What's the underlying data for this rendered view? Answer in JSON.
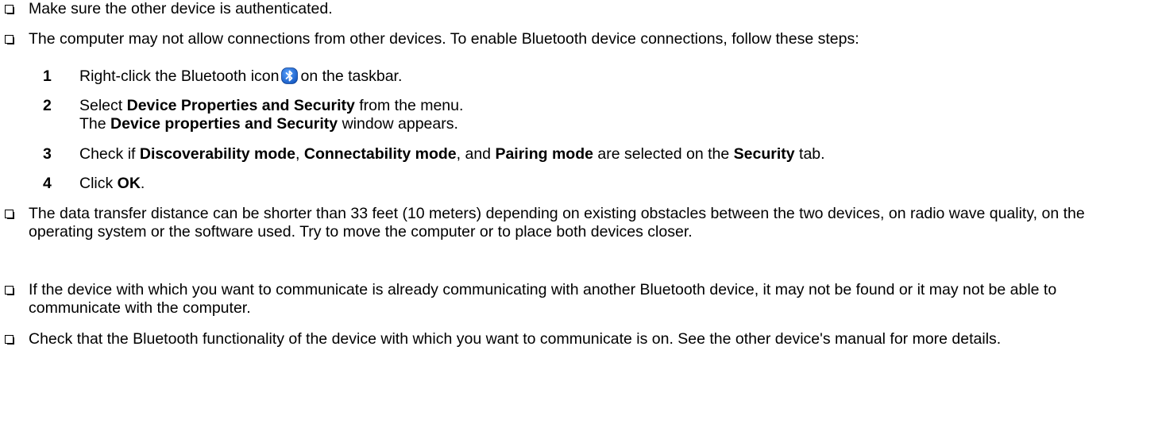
{
  "bullets": [
    {
      "text": "Make sure the other device is authenticated."
    },
    {
      "text": "The computer may not allow connections from other devices. To enable Bluetooth device connections, follow these steps:"
    },
    {
      "text": "The data transfer distance can be shorter than 33 feet (10 meters) depending on existing obstacles between the two devices, on radio wave quality, on the operating system or the software used. Try to move the computer or to place both devices closer."
    },
    {
      "text": "If the device with which you want to communicate is already communicating with another Bluetooth device, it may not be found or it may not be able to communicate with the computer."
    },
    {
      "text": "Check that the Bluetooth functionality of the device with which you want to communicate is on. See the other device's manual for more details."
    }
  ],
  "steps": [
    {
      "number": "1",
      "before": "Right-click the Bluetooth icon",
      "icon": "bluetooth-icon",
      "after": "on the taskbar."
    },
    {
      "number": "2",
      "line1_a": "Select ",
      "line1_b": "Device Properties and Security",
      "line1_c": " from the menu.",
      "line2_a": "The ",
      "line2_b": "Device properties and Security",
      "line2_c": " window appears."
    },
    {
      "number": "3",
      "a": "Check if ",
      "b": "Discoverability mode",
      "c": ", ",
      "d": "Connectability mode",
      "e": ", and ",
      "f": "Pairing mode",
      "g": " are selected on the ",
      "h": "Security",
      "i": " tab."
    },
    {
      "number": "4",
      "a": "Click ",
      "b": "OK",
      "c": "."
    }
  ],
  "colors": {
    "text": "#000000",
    "bluetooth_bg": "#1f6fd6"
  }
}
